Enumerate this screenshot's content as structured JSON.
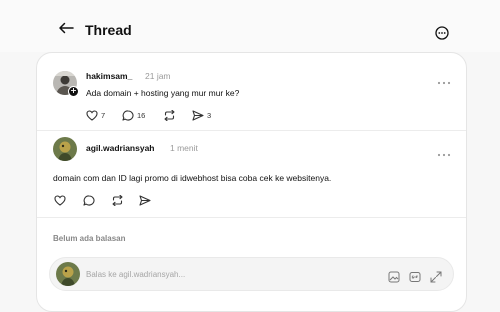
{
  "header": {
    "title": "Thread",
    "back_icon": "arrow-left-icon",
    "more_icon": "more-circle-icon"
  },
  "original_post": {
    "username": "hakimsam_",
    "time": "21 jam",
    "text": "Ada domain + hosting yang mur mur ke?",
    "likes": "7",
    "comments": "16",
    "reposts": "",
    "shares": "3"
  },
  "reply_post": {
    "username": "agil.wadriansyah",
    "time": "1 menit",
    "text": "domain com dan ID lagi promo di idwebhost bisa coba cek ke websitenya."
  },
  "no_replies_label": "Belum ada balasan",
  "reply_box": {
    "placeholder": "Balas ke agil.wadriansyah..."
  },
  "colors": {
    "background": "#f7f7f7",
    "card": "#ffffff",
    "muted": "#9a9a9a"
  }
}
